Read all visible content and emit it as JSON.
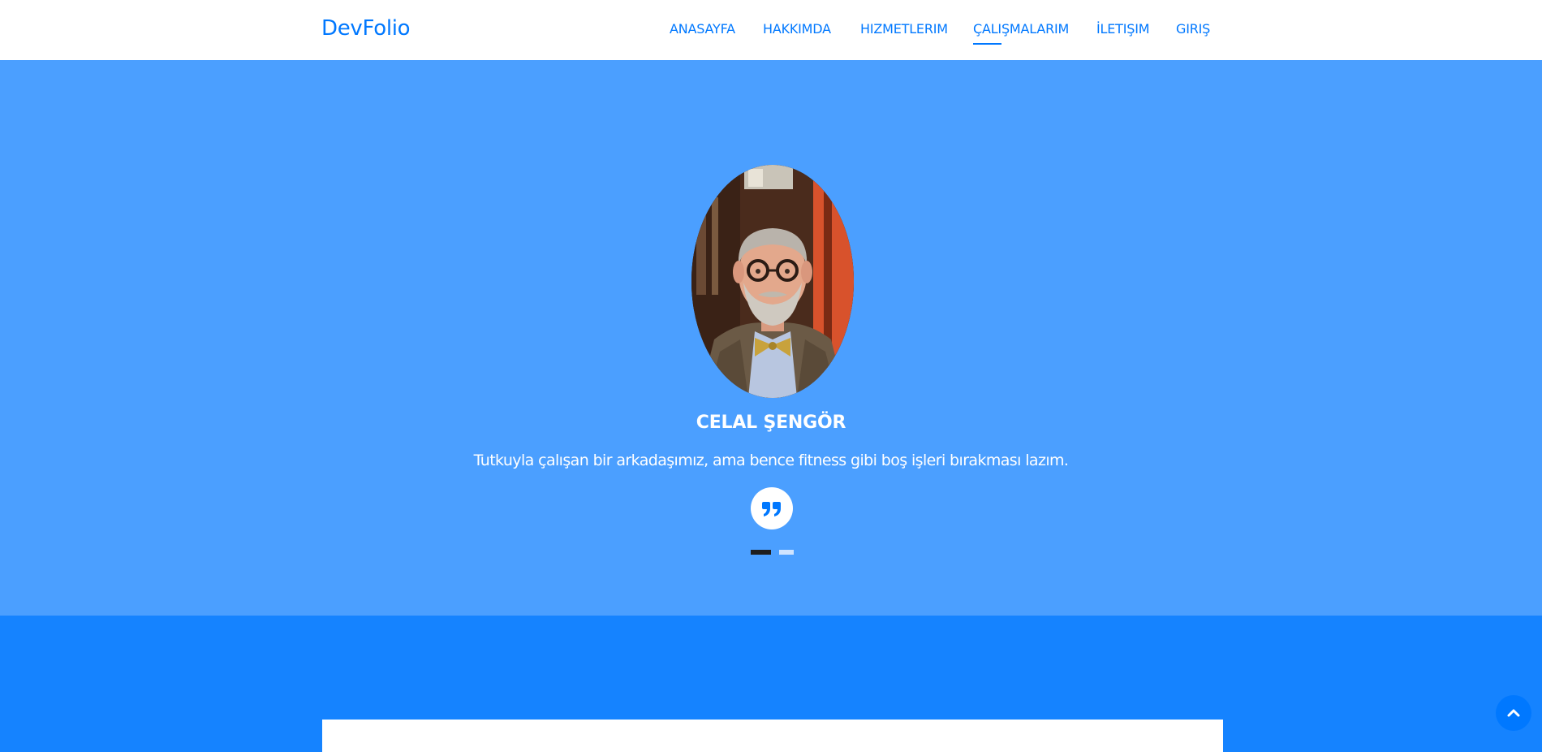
{
  "brand": "DevFolio",
  "nav": {
    "items": [
      {
        "label": "ANASAYFA"
      },
      {
        "label": "HAKKIMDA"
      },
      {
        "label": "HIZMETLERIM"
      },
      {
        "label": "ÇALIŞMALARIM",
        "active": true
      },
      {
        "label": "İLETIŞIM"
      },
      {
        "label": "GIRIŞ"
      }
    ]
  },
  "testimonial": {
    "name": "CELAL ŞENGÖR",
    "quote": "Tutkuyla çalışan bir arkadaşımız, ama bence fitness gibi boş işleri bırakması lazım.",
    "quote_icon": "quote-right-icon",
    "portrait": "person-portrait",
    "slides": {
      "count": 2,
      "active": 1
    }
  },
  "back_to_top_icon": "chevron-up-icon",
  "colors": {
    "primary": "#0078ff",
    "hero_bg": "#4b9fff",
    "section_bg": "#1583ff",
    "navbar_bg": "#ffffff"
  }
}
